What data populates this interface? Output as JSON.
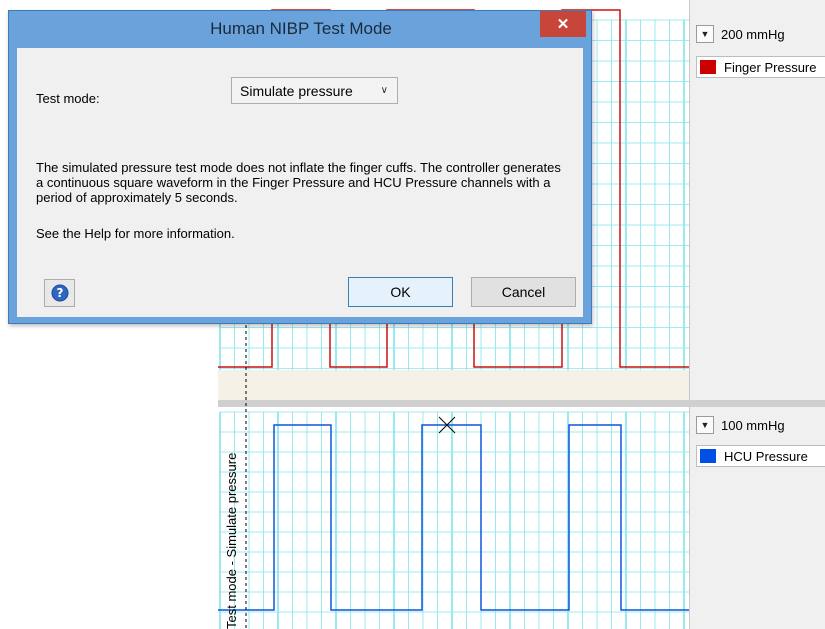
{
  "dialog": {
    "title": "Human NIBP Test Mode",
    "close_label": "✕",
    "test_mode_label": "Test mode:",
    "test_mode_value": "Simulate pressure",
    "description": "The simulated pressure test mode does not inflate the finger cuffs. The controller generates a continuous square waveform in the Finger Pressure and HCU Pressure channels with a period of approximately 5 seconds.",
    "help_text": "See the Help for more information.",
    "ok_label": "OK",
    "cancel_label": "Cancel"
  },
  "channels": [
    {
      "scale": "200 mmHg",
      "name": "Finger Pressure",
      "color": "#cc0000"
    },
    {
      "scale": "100 mmHg",
      "name": "HCU Pressure",
      "color": "#0050e6"
    }
  ],
  "annotation": "Test mode - Simulate pressure",
  "colors": {
    "grid": "#82e4ec",
    "finger_wave": "#cc1111",
    "hcu_wave": "#1155dd",
    "separator": "#bdbdbd"
  }
}
